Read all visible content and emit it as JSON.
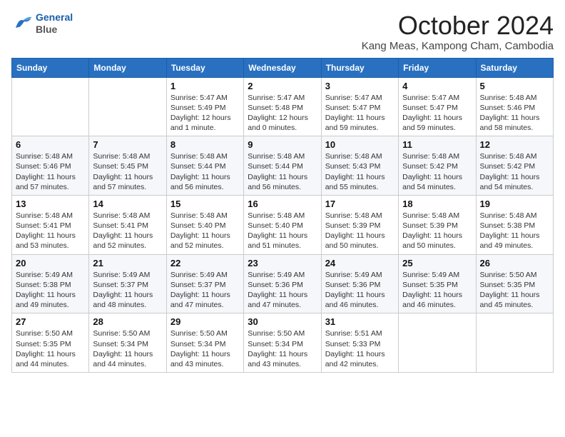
{
  "header": {
    "logo_line1": "General",
    "logo_line2": "Blue",
    "title": "October 2024",
    "subtitle": "Kang Meas, Kampong Cham, Cambodia"
  },
  "weekdays": [
    "Sunday",
    "Monday",
    "Tuesday",
    "Wednesday",
    "Thursday",
    "Friday",
    "Saturday"
  ],
  "weeks": [
    [
      {
        "day": "",
        "sunrise": "",
        "sunset": "",
        "daylight": ""
      },
      {
        "day": "",
        "sunrise": "",
        "sunset": "",
        "daylight": ""
      },
      {
        "day": "1",
        "sunrise": "Sunrise: 5:47 AM",
        "sunset": "Sunset: 5:49 PM",
        "daylight": "Daylight: 12 hours and 1 minute."
      },
      {
        "day": "2",
        "sunrise": "Sunrise: 5:47 AM",
        "sunset": "Sunset: 5:48 PM",
        "daylight": "Daylight: 12 hours and 0 minutes."
      },
      {
        "day": "3",
        "sunrise": "Sunrise: 5:47 AM",
        "sunset": "Sunset: 5:47 PM",
        "daylight": "Daylight: 11 hours and 59 minutes."
      },
      {
        "day": "4",
        "sunrise": "Sunrise: 5:47 AM",
        "sunset": "Sunset: 5:47 PM",
        "daylight": "Daylight: 11 hours and 59 minutes."
      },
      {
        "day": "5",
        "sunrise": "Sunrise: 5:48 AM",
        "sunset": "Sunset: 5:46 PM",
        "daylight": "Daylight: 11 hours and 58 minutes."
      }
    ],
    [
      {
        "day": "6",
        "sunrise": "Sunrise: 5:48 AM",
        "sunset": "Sunset: 5:46 PM",
        "daylight": "Daylight: 11 hours and 57 minutes."
      },
      {
        "day": "7",
        "sunrise": "Sunrise: 5:48 AM",
        "sunset": "Sunset: 5:45 PM",
        "daylight": "Daylight: 11 hours and 57 minutes."
      },
      {
        "day": "8",
        "sunrise": "Sunrise: 5:48 AM",
        "sunset": "Sunset: 5:44 PM",
        "daylight": "Daylight: 11 hours and 56 minutes."
      },
      {
        "day": "9",
        "sunrise": "Sunrise: 5:48 AM",
        "sunset": "Sunset: 5:44 PM",
        "daylight": "Daylight: 11 hours and 56 minutes."
      },
      {
        "day": "10",
        "sunrise": "Sunrise: 5:48 AM",
        "sunset": "Sunset: 5:43 PM",
        "daylight": "Daylight: 11 hours and 55 minutes."
      },
      {
        "day": "11",
        "sunrise": "Sunrise: 5:48 AM",
        "sunset": "Sunset: 5:42 PM",
        "daylight": "Daylight: 11 hours and 54 minutes."
      },
      {
        "day": "12",
        "sunrise": "Sunrise: 5:48 AM",
        "sunset": "Sunset: 5:42 PM",
        "daylight": "Daylight: 11 hours and 54 minutes."
      }
    ],
    [
      {
        "day": "13",
        "sunrise": "Sunrise: 5:48 AM",
        "sunset": "Sunset: 5:41 PM",
        "daylight": "Daylight: 11 hours and 53 minutes."
      },
      {
        "day": "14",
        "sunrise": "Sunrise: 5:48 AM",
        "sunset": "Sunset: 5:41 PM",
        "daylight": "Daylight: 11 hours and 52 minutes."
      },
      {
        "day": "15",
        "sunrise": "Sunrise: 5:48 AM",
        "sunset": "Sunset: 5:40 PM",
        "daylight": "Daylight: 11 hours and 52 minutes."
      },
      {
        "day": "16",
        "sunrise": "Sunrise: 5:48 AM",
        "sunset": "Sunset: 5:40 PM",
        "daylight": "Daylight: 11 hours and 51 minutes."
      },
      {
        "day": "17",
        "sunrise": "Sunrise: 5:48 AM",
        "sunset": "Sunset: 5:39 PM",
        "daylight": "Daylight: 11 hours and 50 minutes."
      },
      {
        "day": "18",
        "sunrise": "Sunrise: 5:48 AM",
        "sunset": "Sunset: 5:39 PM",
        "daylight": "Daylight: 11 hours and 50 minutes."
      },
      {
        "day": "19",
        "sunrise": "Sunrise: 5:48 AM",
        "sunset": "Sunset: 5:38 PM",
        "daylight": "Daylight: 11 hours and 49 minutes."
      }
    ],
    [
      {
        "day": "20",
        "sunrise": "Sunrise: 5:49 AM",
        "sunset": "Sunset: 5:38 PM",
        "daylight": "Daylight: 11 hours and 49 minutes."
      },
      {
        "day": "21",
        "sunrise": "Sunrise: 5:49 AM",
        "sunset": "Sunset: 5:37 PM",
        "daylight": "Daylight: 11 hours and 48 minutes."
      },
      {
        "day": "22",
        "sunrise": "Sunrise: 5:49 AM",
        "sunset": "Sunset: 5:37 PM",
        "daylight": "Daylight: 11 hours and 47 minutes."
      },
      {
        "day": "23",
        "sunrise": "Sunrise: 5:49 AM",
        "sunset": "Sunset: 5:36 PM",
        "daylight": "Daylight: 11 hours and 47 minutes."
      },
      {
        "day": "24",
        "sunrise": "Sunrise: 5:49 AM",
        "sunset": "Sunset: 5:36 PM",
        "daylight": "Daylight: 11 hours and 46 minutes."
      },
      {
        "day": "25",
        "sunrise": "Sunrise: 5:49 AM",
        "sunset": "Sunset: 5:35 PM",
        "daylight": "Daylight: 11 hours and 46 minutes."
      },
      {
        "day": "26",
        "sunrise": "Sunrise: 5:50 AM",
        "sunset": "Sunset: 5:35 PM",
        "daylight": "Daylight: 11 hours and 45 minutes."
      }
    ],
    [
      {
        "day": "27",
        "sunrise": "Sunrise: 5:50 AM",
        "sunset": "Sunset: 5:35 PM",
        "daylight": "Daylight: 11 hours and 44 minutes."
      },
      {
        "day": "28",
        "sunrise": "Sunrise: 5:50 AM",
        "sunset": "Sunset: 5:34 PM",
        "daylight": "Daylight: 11 hours and 44 minutes."
      },
      {
        "day": "29",
        "sunrise": "Sunrise: 5:50 AM",
        "sunset": "Sunset: 5:34 PM",
        "daylight": "Daylight: 11 hours and 43 minutes."
      },
      {
        "day": "30",
        "sunrise": "Sunrise: 5:50 AM",
        "sunset": "Sunset: 5:34 PM",
        "daylight": "Daylight: 11 hours and 43 minutes."
      },
      {
        "day": "31",
        "sunrise": "Sunrise: 5:51 AM",
        "sunset": "Sunset: 5:33 PM",
        "daylight": "Daylight: 11 hours and 42 minutes."
      },
      {
        "day": "",
        "sunrise": "",
        "sunset": "",
        "daylight": ""
      },
      {
        "day": "",
        "sunrise": "",
        "sunset": "",
        "daylight": ""
      }
    ]
  ]
}
